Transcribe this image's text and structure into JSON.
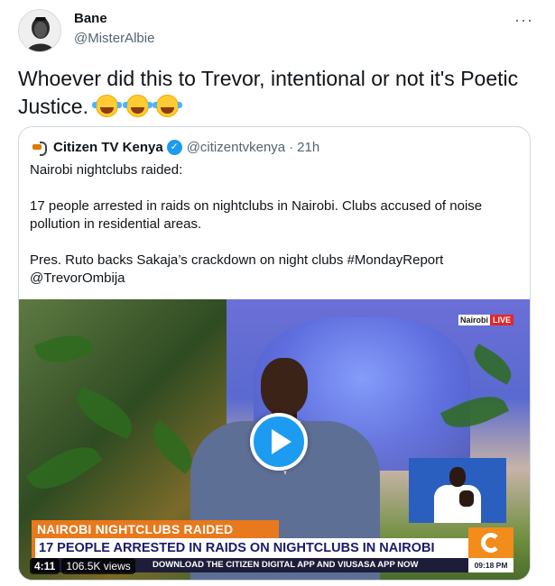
{
  "author": {
    "name": "Bane",
    "handle": "@MisterAlbie",
    "avatar_icon": "avatar-illustration-icon"
  },
  "more_label": "···",
  "tweet": {
    "text": "Whoever did this to Trevor, intentional or not it's Poetic Justice.",
    "emoji_icon": "face-with-tears-of-joy-icon",
    "emoji_count": 3
  },
  "quoted": {
    "name": "Citizen TV Kenya",
    "verified": true,
    "handle": "@citizentvkenya",
    "dot": "·",
    "time": "21h",
    "line1": "Nairobi nightclubs raided:",
    "line2": "17 people arrested in raids on nightclubs in Nairobi. Clubs accused of noise pollution in residential areas.",
    "line3": "Pres. Ruto backs Sakaja’s crackdown on night clubs #MondayReport @TrevorOmbija"
  },
  "video": {
    "channel_tag": "Nairobi",
    "live_tag": "LIVE",
    "headline": "NAIROBI NIGHTCLUBS RAIDED",
    "subheadline": "17 PEOPLE ARRESTED IN RAIDS ON NIGHTCLUBS IN NAIROBI",
    "ticker": "DOWNLOAD THE CITIZEN DIGITAL APP AND VIUSASA APP NOW",
    "clock": "09:18 PM",
    "duration": "4:11",
    "views": "106.5K views"
  },
  "colors": {
    "accent": "#1d9bf0",
    "border": "#cfd9de",
    "muted_text": "#536471",
    "lower_third_orange": "#e8791d"
  }
}
